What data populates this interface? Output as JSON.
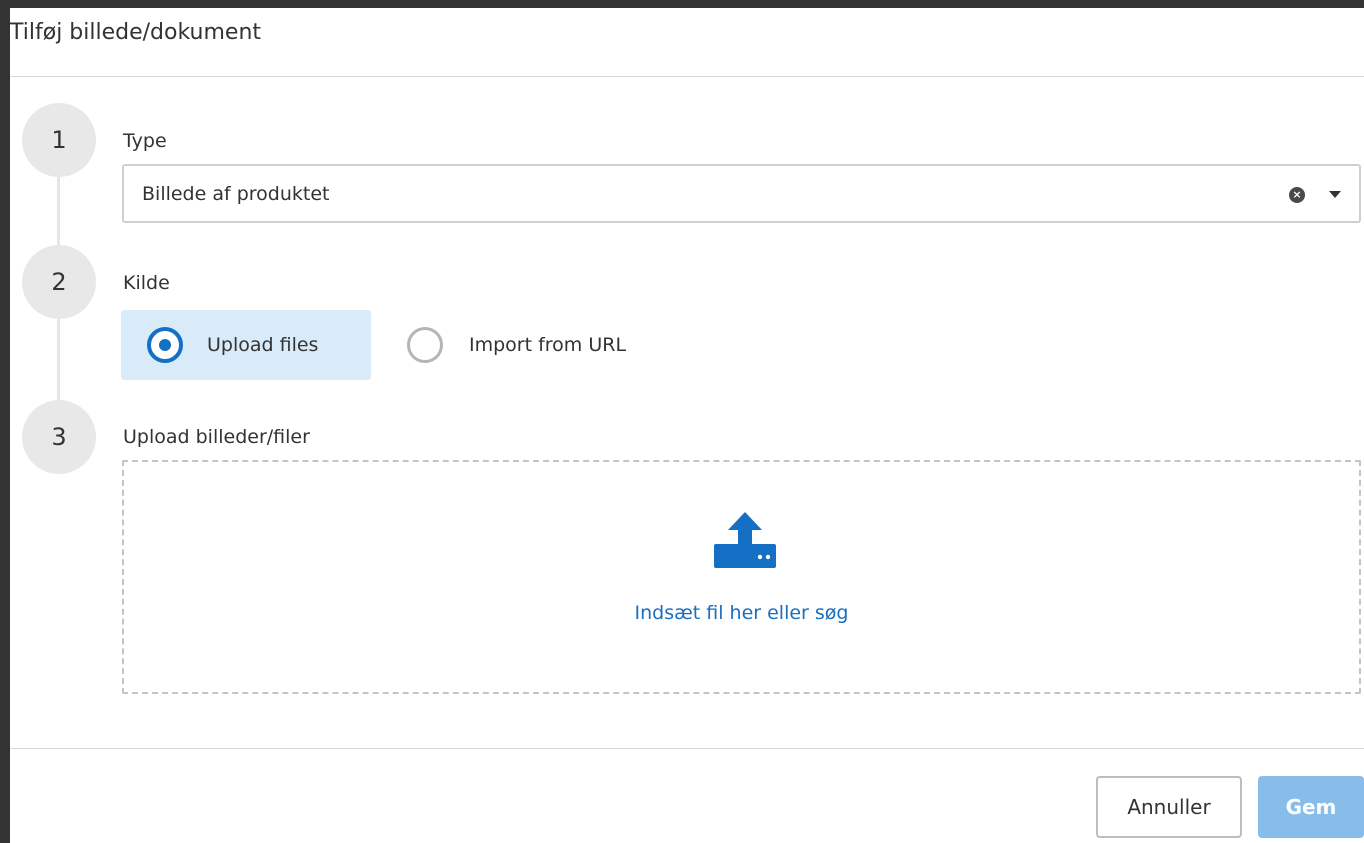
{
  "dialog": {
    "title": "Tilføj billede/dokument"
  },
  "steps": [
    {
      "number": "1",
      "label": "Type"
    },
    {
      "number": "2",
      "label": "Kilde"
    },
    {
      "number": "3",
      "label": "Upload billeder/filer"
    }
  ],
  "type_select": {
    "value": "Billede af produktet",
    "clear_icon": "clear-circle-icon",
    "caret_icon": "caret-down-icon"
  },
  "source": {
    "options": [
      {
        "label": "Upload files",
        "selected": true
      },
      {
        "label": "Import from URL",
        "selected": false
      }
    ]
  },
  "dropzone": {
    "icon": "upload-icon",
    "text": "Indsæt fil her eller søg"
  },
  "footer": {
    "cancel_label": "Annuller",
    "save_label": "Gem"
  },
  "colors": {
    "accent": "#1470c4",
    "link": "#1a6fbf",
    "selected_bg": "#d9eaf9",
    "save_disabled_bg": "#88bde9"
  }
}
